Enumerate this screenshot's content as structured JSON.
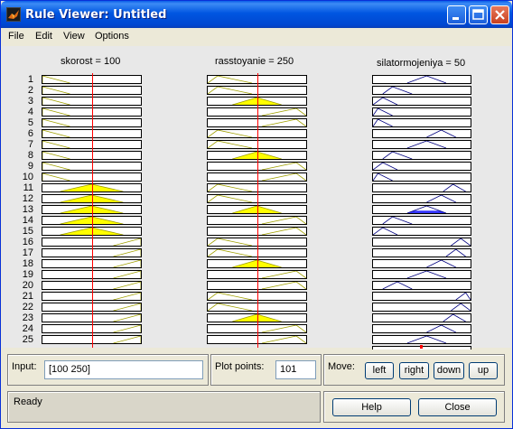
{
  "window": {
    "title": "Rule Viewer: Untitled",
    "icon": "matlab-icon"
  },
  "menu": [
    "File",
    "Edit",
    "View",
    "Options"
  ],
  "columns": [
    {
      "title": "skorost = 100",
      "role": "input"
    },
    {
      "title": "rasstoyanie = 250",
      "role": "input"
    },
    {
      "title": "silatormojeniya = 50",
      "role": "output"
    }
  ],
  "rules": [
    "1",
    "2",
    "3",
    "4",
    "5",
    "6",
    "7",
    "8",
    "9",
    "10",
    "11",
    "12",
    "13",
    "14",
    "15",
    "16",
    "17",
    "18",
    "19",
    "20",
    "21",
    "22",
    "23",
    "24",
    "25"
  ],
  "input_row": {
    "input_label": "Input:",
    "input_value": "[100 250]",
    "plot_points_label": "Plot points:",
    "plot_points_value": "101",
    "move_label": "Move:",
    "move_buttons": [
      "left",
      "right",
      "down",
      "up"
    ]
  },
  "status": {
    "text": "Ready"
  },
  "actions": {
    "help": "Help",
    "close": "Close"
  },
  "colors": {
    "title_bar": "#0054e3",
    "fired_fill": "#ffff00",
    "output_fill": "#3333ff",
    "input_line": "#a0a000",
    "output_line": "#000080",
    "cursor_line": "#ff0000"
  }
}
